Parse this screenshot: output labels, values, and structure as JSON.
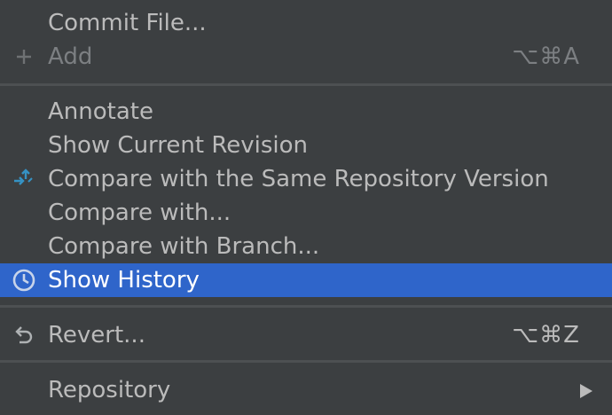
{
  "menu": {
    "items": [
      {
        "label": "Commit File...",
        "shortcut": "",
        "enabled": true
      },
      {
        "label": "Add",
        "shortcut": "⌥⌘A",
        "enabled": false,
        "icon": "plus-icon"
      },
      {
        "label": "Annotate",
        "shortcut": "",
        "enabled": true
      },
      {
        "label": "Show Current Revision",
        "shortcut": "",
        "enabled": true
      },
      {
        "label": "Compare with the Same Repository Version",
        "shortcut": "",
        "enabled": true,
        "icon": "compare-arrows-icon"
      },
      {
        "label": "Compare with...",
        "shortcut": "",
        "enabled": true
      },
      {
        "label": "Compare with Branch...",
        "shortcut": "",
        "enabled": true
      },
      {
        "label": "Show History",
        "shortcut": "",
        "enabled": true,
        "selected": true,
        "icon": "clock-icon"
      },
      {
        "label": "Revert...",
        "shortcut": "⌥⌘Z",
        "enabled": true,
        "icon": "undo-icon"
      },
      {
        "label": "Repository",
        "shortcut": "",
        "enabled": true,
        "submenu": true
      }
    ]
  },
  "colors": {
    "background": "#3c3f41",
    "text": "#bbbbbb",
    "disabled_text": "#7c7f82",
    "selection": "#2f65ca",
    "separator": "#4d5052",
    "compare_icon": "#3592c4"
  }
}
